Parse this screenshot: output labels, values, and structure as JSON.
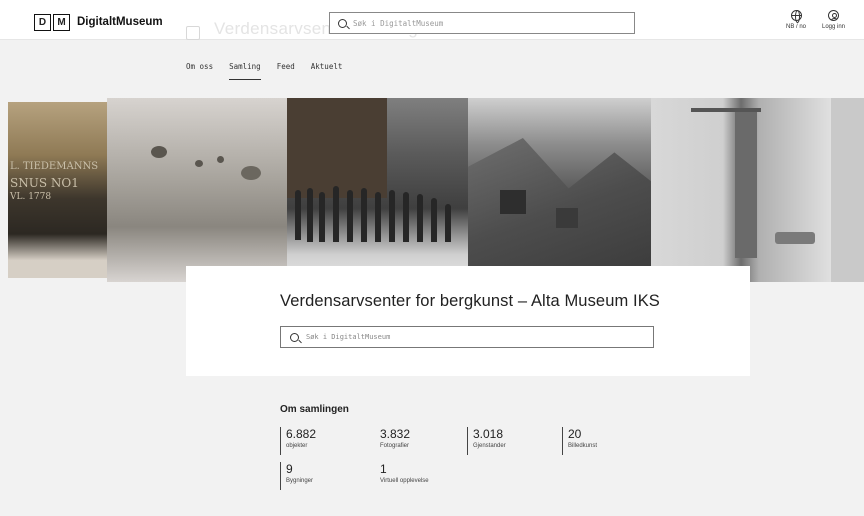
{
  "header": {
    "logo_letters": [
      "D",
      "M"
    ],
    "logo_name": "DigitaltMuseum",
    "ghost_title": "Verdensarvsenter for bergkunst – Alta Museum IKS",
    "search_placeholder": "Søk i DigitaltMuseum",
    "language_label": "NB / no",
    "login_label": "Logg inn"
  },
  "tabs": [
    {
      "label": "Om oss",
      "active": false
    },
    {
      "label": "Samling",
      "active": true
    },
    {
      "label": "Feed",
      "active": false
    },
    {
      "label": "Aktuelt",
      "active": false
    }
  ],
  "mosaic_text": {
    "line1": "L. TIEDEMANNS",
    "line2": "SNUS NO1",
    "line3": "VL. 1778"
  },
  "card": {
    "title": "Verdensarvsenter for bergkunst – Alta Museum IKS",
    "search_placeholder": "Søk i DigitaltMuseum"
  },
  "about": {
    "title": "Om samlingen",
    "stats": [
      {
        "value": "6.882",
        "label": "objekter"
      },
      {
        "value": "3.832",
        "label": "Fotografier"
      },
      {
        "value": "3.018",
        "label": "Gjenstander"
      },
      {
        "value": "20",
        "label": "Billedkunst"
      },
      {
        "value": "9",
        "label": "Bygninger"
      },
      {
        "value": "1",
        "label": "Virtuell opplevelse"
      }
    ]
  }
}
